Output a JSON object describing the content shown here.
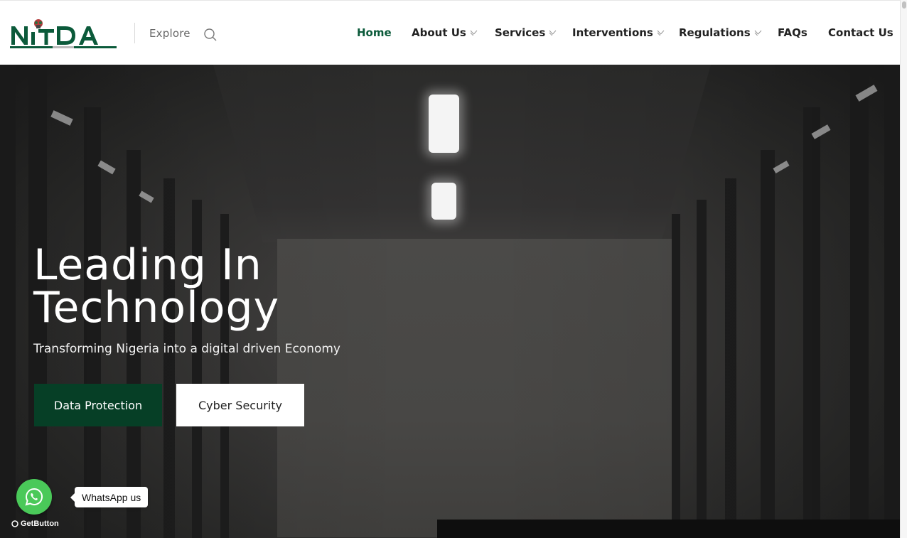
{
  "header": {
    "logo_text": "NITDA",
    "explore_label": "Explore",
    "nav": [
      {
        "label": "Home",
        "active": true,
        "has_dropdown": false
      },
      {
        "label": "About Us",
        "active": false,
        "has_dropdown": true
      },
      {
        "label": "Services",
        "active": false,
        "has_dropdown": true
      },
      {
        "label": "Interventions",
        "active": false,
        "has_dropdown": true
      },
      {
        "label": "Regulations",
        "active": false,
        "has_dropdown": true
      },
      {
        "label": "FAQs",
        "active": false,
        "has_dropdown": false
      },
      {
        "label": "Contact Us",
        "active": false,
        "has_dropdown": false
      }
    ]
  },
  "hero": {
    "title_line1": "Leading In",
    "title_line2": "Technology",
    "subtitle": "Transforming Nigeria into a digital driven Economy",
    "primary_button": "Data Protection",
    "secondary_button": "Cyber Security"
  },
  "whatsapp": {
    "tooltip": "WhatsApp us",
    "powered_by": "GetButton"
  },
  "colors": {
    "brand_green": "#0b5a3a",
    "button_green": "#063f26",
    "whatsapp_green": "#4ac959"
  }
}
